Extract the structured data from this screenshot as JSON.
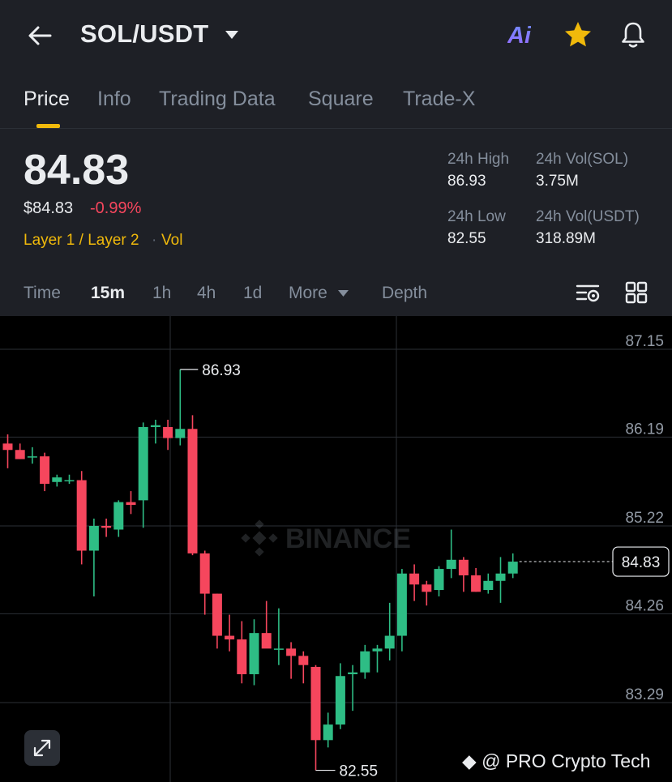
{
  "header": {
    "pair": "SOL/USDT"
  },
  "tabs": [
    {
      "label": "Price"
    },
    {
      "label": "Info"
    },
    {
      "label": "Trading Data"
    },
    {
      "label": "Square"
    },
    {
      "label": "Trade-X"
    }
  ],
  "price": {
    "last": "84.83",
    "usd": "$84.83",
    "change": "-0.99%",
    "tag1": "Layer 1 / Layer 2",
    "tag2": "Vol"
  },
  "stats": {
    "high_label": "24h High",
    "high": "86.93",
    "low_label": "24h Low",
    "low": "82.55",
    "vol_base_label": "24h Vol(SOL)",
    "vol_base": "3.75M",
    "vol_quote_label": "24h Vol(USDT)",
    "vol_quote": "318.89M"
  },
  "intervals": {
    "time": "Time",
    "m15": "15m",
    "h1": "1h",
    "h4": "4h",
    "d1": "1d",
    "more": "More",
    "depth": "Depth"
  },
  "chart": {
    "y_labels": [
      "87.15",
      "86.19",
      "85.22",
      "84.26",
      "83.29"
    ],
    "current_price_label": "84.83",
    "high_marker": "86.93",
    "low_marker": "82.55",
    "watermark_brand": "BINANCE",
    "colors": {
      "up": "#2ebd85",
      "down": "#f6465d",
      "accent": "#f0b90b"
    }
  },
  "chart_data": {
    "type": "candlestick",
    "interval": "15m",
    "candles": [
      [
        86.12,
        86.22,
        85.85,
        86.05
      ],
      [
        86.05,
        86.12,
        85.95,
        85.95
      ],
      [
        85.98,
        86.08,
        85.9,
        85.98
      ],
      [
        85.98,
        86.02,
        85.6,
        85.68
      ],
      [
        85.7,
        85.78,
        85.65,
        85.75
      ],
      [
        85.72,
        85.78,
        85.68,
        85.72
      ],
      [
        85.72,
        85.82,
        84.8,
        84.95
      ],
      [
        84.95,
        85.3,
        84.45,
        85.22
      ],
      [
        85.22,
        85.3,
        85.1,
        85.2
      ],
      [
        85.18,
        85.5,
        85.1,
        85.48
      ],
      [
        85.48,
        85.6,
        85.35,
        85.45
      ],
      [
        85.5,
        86.35,
        85.2,
        86.3
      ],
      [
        86.3,
        86.38,
        86.12,
        86.32
      ],
      [
        86.3,
        86.38,
        86.05,
        86.18
      ],
      [
        86.18,
        86.93,
        86.1,
        86.28
      ],
      [
        86.28,
        86.43,
        84.9,
        84.92
      ],
      [
        84.92,
        84.95,
        84.25,
        84.48
      ],
      [
        84.48,
        84.48,
        83.88,
        84.02
      ],
      [
        84.02,
        84.25,
        83.85,
        83.98
      ],
      [
        83.98,
        84.18,
        83.5,
        83.6
      ],
      [
        83.6,
        84.2,
        83.48,
        84.05
      ],
      [
        84.05,
        84.4,
        84.0,
        83.88
      ],
      [
        83.88,
        84.32,
        83.7,
        83.88
      ],
      [
        83.88,
        83.95,
        83.55,
        83.8
      ],
      [
        83.8,
        83.85,
        83.5,
        83.7
      ],
      [
        83.68,
        83.7,
        82.55,
        82.88
      ],
      [
        82.88,
        83.18,
        82.8,
        83.05
      ],
      [
        83.05,
        83.72,
        83.0,
        83.58
      ],
      [
        83.6,
        83.7,
        83.2,
        83.62
      ],
      [
        83.62,
        83.92,
        83.55,
        83.85
      ],
      [
        83.85,
        83.92,
        83.62,
        83.88
      ],
      [
        83.88,
        84.38,
        83.75,
        84.02
      ],
      [
        84.02,
        84.75,
        83.85,
        84.7
      ],
      [
        84.7,
        84.8,
        84.4,
        84.58
      ],
      [
        84.58,
        84.62,
        84.35,
        84.5
      ],
      [
        84.52,
        84.78,
        84.45,
        84.75
      ],
      [
        84.75,
        85.18,
        84.65,
        84.85
      ],
      [
        84.85,
        84.88,
        84.5,
        84.68
      ],
      [
        84.68,
        84.76,
        84.5,
        84.5
      ],
      [
        84.52,
        84.7,
        84.48,
        84.62
      ],
      [
        84.62,
        84.88,
        84.38,
        84.7
      ],
      [
        84.7,
        84.92,
        84.65,
        84.83
      ]
    ],
    "ylim": [
      82.25,
      87.45
    ]
  }
}
